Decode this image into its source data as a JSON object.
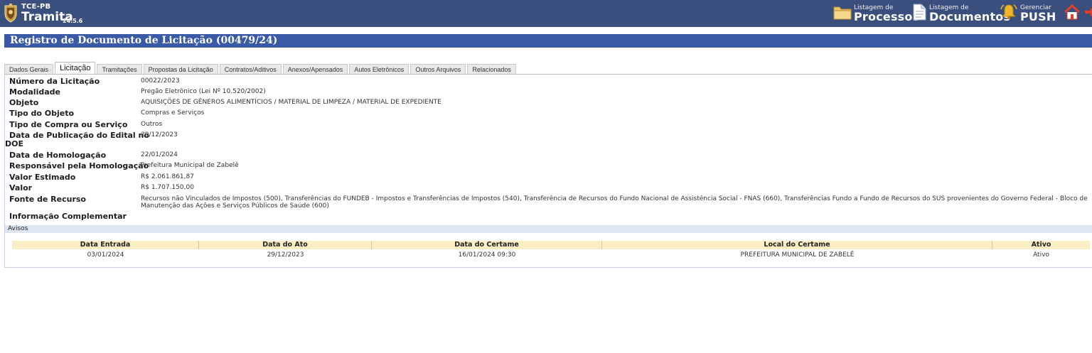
{
  "header": {
    "org": "TCE-PB",
    "app": "Tramita",
    "version": "24.5.6",
    "buttons": {
      "processos": {
        "small": "Listagem de",
        "big": "Processos",
        "icon": "folder-icon"
      },
      "documentos": {
        "small": "Listagem de",
        "big": "Documentos",
        "icon": "document-icon"
      },
      "push": {
        "small": "Gerenciar",
        "big": "PUSH",
        "icon": "bell-icon"
      },
      "home": {
        "icon": "home-icon"
      },
      "exit": {
        "icon": "exit-icon"
      }
    },
    "colors": {
      "bar": "#3b4f7f",
      "panel_title": "#3b5aa6"
    }
  },
  "panel": {
    "title": "Registro de Documento de Licitação (00479/24)"
  },
  "tabs": [
    {
      "label": "Dados Gerais",
      "active": false
    },
    {
      "label": "Licitação",
      "active": true
    },
    {
      "label": "Tramitações",
      "active": false
    },
    {
      "label": "Propostas da Licitação",
      "active": false
    },
    {
      "label": "Contratos/Aditivos",
      "active": false
    },
    {
      "label": "Anexos/Apensados",
      "active": false
    },
    {
      "label": "Autos Eletrônicos",
      "active": false
    },
    {
      "label": "Outros Arquivos",
      "active": false
    },
    {
      "label": "Relacionados",
      "active": false
    }
  ],
  "fields": {
    "numero": {
      "label": "Número da Licitação",
      "value": "00022/2023"
    },
    "modalidade": {
      "label": "Modalidade",
      "value": "Pregão Eletrônico (Lei Nº 10.520/2002)"
    },
    "objeto": {
      "label": "Objeto",
      "value": "AQUISIÇÕES DE GÊNEROS ALIMENTÍCIOS / MATERIAL DE LIMPEZA / MATERIAL DE EXPEDIENTE"
    },
    "tipo_objeto": {
      "label": "Tipo do Objeto",
      "value": "Compras e Serviços"
    },
    "tipo_compra": {
      "label": "Tipo de Compra ou Serviço",
      "value": "Outros"
    },
    "data_publicacao": {
      "label_line1": "Data de Publicação do Edital no",
      "label_line2": "DOE",
      "value": "29/12/2023"
    },
    "data_homologacao": {
      "label": "Data de Homologação",
      "value": "22/01/2024"
    },
    "responsavel": {
      "label": "Responsável pela Homologação",
      "value": "Prefeitura Municipal de Zabelê"
    },
    "valor_estimado": {
      "label": "Valor Estimado",
      "value": "R$ 2.061.861,87"
    },
    "valor": {
      "label": "Valor",
      "value": "R$ 1.707.150,00"
    },
    "fonte": {
      "label": "Fonte de Recurso",
      "value_line1": "Recursos não Vinculados de Impostos (500), Transferências do FUNDEB - Impostos e Transferências de Impostos (540), Transferência de Recursos do Fundo Nacional de Assistência Social - FNAS (660), Transferências Fundo a Fundo de Recursos do SUS provenientes do Governo Federal - Bloco de",
      "value_line2": "Manutenção das Ações e Serviços Públicos de Saúde (600)"
    },
    "info_complementar": {
      "label": "Informação Complementar",
      "value": ""
    }
  },
  "avisos": {
    "title": "Avisos",
    "columns": [
      "Data Entrada",
      "Data do Ato",
      "Data do Certame",
      "Local do Certame",
      "Ativo"
    ],
    "rows": [
      [
        "03/01/2024",
        "29/12/2023",
        "16/01/2024 09:30",
        "PREFEITURA MUNICIPAL DE ZABELÊ",
        "Ativo"
      ]
    ]
  }
}
